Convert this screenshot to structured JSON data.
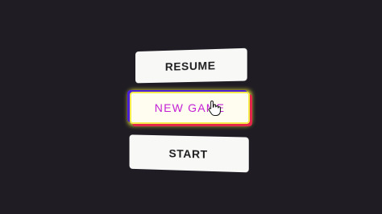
{
  "menu": {
    "resume_label": "RESUME",
    "new_game_label": "NEW GAME",
    "start_label": "START"
  },
  "colors": {
    "background": "#1f1c24",
    "button_bg": "#f8f8f6",
    "button_text": "#1d1d1f",
    "highlight_text": "#c421d6",
    "glow_yellow": "#f2e83c",
    "glow_blue": "#4b1fd6",
    "glow_red": "#e4264a"
  },
  "cursor": {
    "icon": "hand-pointer-icon"
  }
}
